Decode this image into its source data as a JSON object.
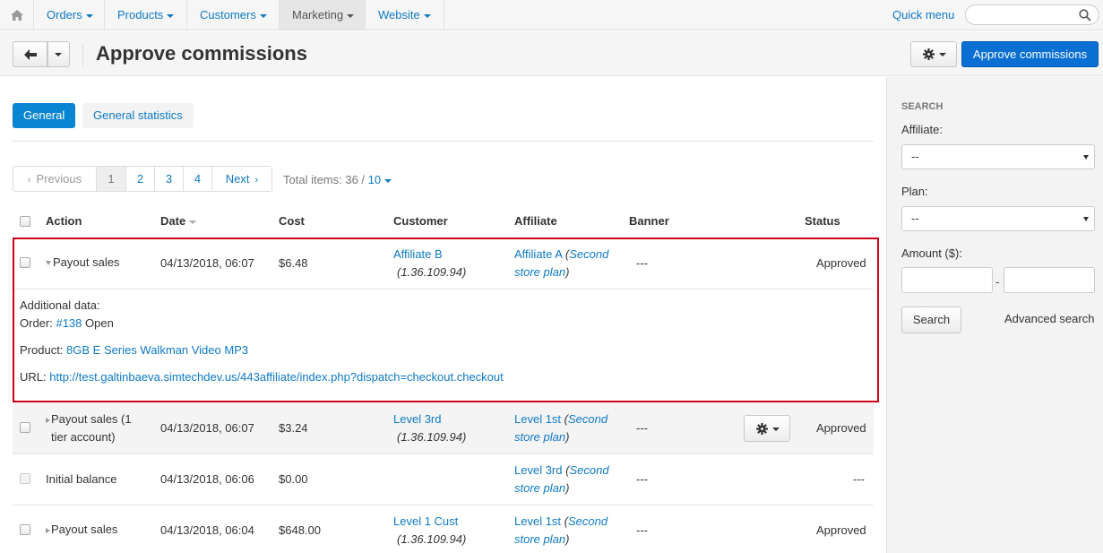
{
  "nav": {
    "items": [
      {
        "label": "Orders"
      },
      {
        "label": "Products"
      },
      {
        "label": "Customers"
      },
      {
        "label": "Marketing"
      },
      {
        "label": "Website"
      }
    ],
    "quick_menu": "Quick menu"
  },
  "header": {
    "title": "Approve commissions",
    "primary_button": "Approve commissions"
  },
  "tabs": [
    "General",
    "General statistics"
  ],
  "pagination": {
    "prev": "Previous",
    "pages": [
      "1",
      "2",
      "3",
      "4"
    ],
    "current": "1",
    "next": "Next",
    "total_label": "Total items: 36 /",
    "per_page": "10"
  },
  "table": {
    "headers": [
      "Action",
      "Date",
      "Cost",
      "Customer",
      "Affiliate",
      "Banner",
      "Status"
    ],
    "rows": [
      {
        "action": "Payout sales",
        "date": "04/13/2018, 06:07",
        "cost": "$6.48",
        "customer": "Affiliate B",
        "customer_ip": "(1.36.109.94)",
        "affiliate": "Affiliate A",
        "plan": "Second store plan",
        "banner": "---",
        "status": "Approved",
        "details": {
          "title": "Additional data:",
          "order_label": "Order:",
          "order_link": "#138",
          "order_status": "Open",
          "product_label": "Product:",
          "product_link": "8GB E Series Walkman Video MP3",
          "url_label": "URL:",
          "url_link": "http://test.galtinbaeva.simtechdev.us/443affiliate/index.php?dispatch=checkout.checkout"
        }
      },
      {
        "action": "Payout sales (1 tier account)",
        "action_line1": "Payout sales (1",
        "action_line2": "tier account)",
        "date": "04/13/2018, 06:07",
        "cost": "$3.24",
        "customer": "Level 3rd",
        "customer_ip": "(1.36.109.94)",
        "affiliate": "Level 1st",
        "plan": "Second store plan",
        "banner": "---",
        "status": "Approved"
      },
      {
        "action": "Initial balance",
        "date": "04/13/2018, 06:06",
        "cost": "$0.00",
        "customer": "",
        "affiliate": "Level 3rd",
        "plan": "Second store plan",
        "banner": "---",
        "status": "---"
      },
      {
        "action": "Payout sales",
        "date": "04/13/2018, 06:04",
        "cost": "$648.00",
        "customer": "Level 1 Cust",
        "customer_ip": "(1.36.109.94)",
        "affiliate": "Level 1st",
        "plan": "Second store plan",
        "banner": "---",
        "status": "Approved"
      }
    ]
  },
  "sidebar": {
    "title": "SEARCH",
    "affiliate_label": "Affiliate:",
    "affiliate_value": "--",
    "plan_label": "Plan:",
    "plan_value": "--",
    "amount_label": "Amount ($):",
    "range_sep": "-",
    "search_button": "Search",
    "advanced_link": "Advanced search"
  },
  "colors": {
    "primary": "#0a6fd2",
    "link": "#0e7ac4",
    "highlight": "#d0021b"
  }
}
